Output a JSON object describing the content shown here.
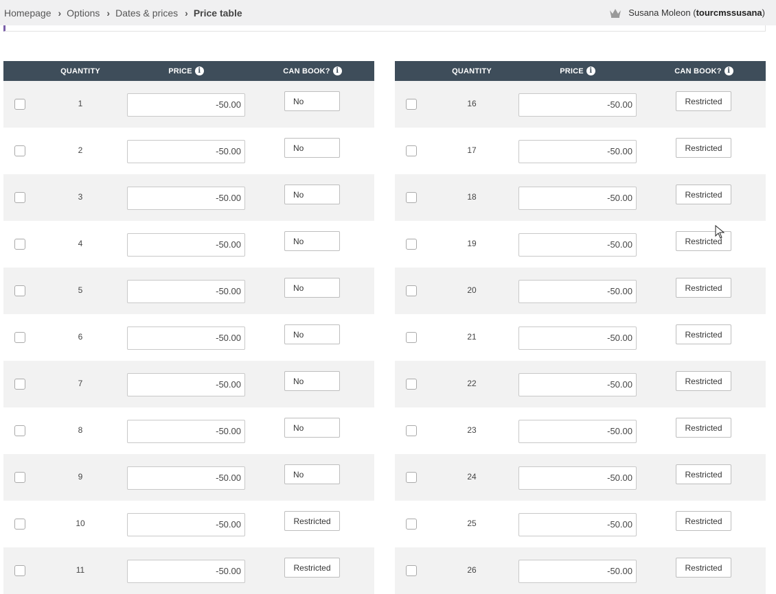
{
  "breadcrumb": {
    "items": [
      "Homepage",
      "Options",
      "Dates & prices"
    ],
    "current": "Price table"
  },
  "user": {
    "name": "Susana Moleon",
    "username_open": "(",
    "username": "tourcmssusana",
    "username_close": ")"
  },
  "table": {
    "headers": {
      "quantity": "QUANTITY",
      "price": "PRICE",
      "can_book": "CAN BOOK?"
    },
    "info_glyph": "i",
    "left_rows": [
      {
        "qty": "1",
        "price": "-50.00",
        "can_book": "No"
      },
      {
        "qty": "2",
        "price": "-50.00",
        "can_book": "No"
      },
      {
        "qty": "3",
        "price": "-50.00",
        "can_book": "No"
      },
      {
        "qty": "4",
        "price": "-50.00",
        "can_book": "No"
      },
      {
        "qty": "5",
        "price": "-50.00",
        "can_book": "No"
      },
      {
        "qty": "6",
        "price": "-50.00",
        "can_book": "No"
      },
      {
        "qty": "7",
        "price": "-50.00",
        "can_book": "No"
      },
      {
        "qty": "8",
        "price": "-50.00",
        "can_book": "No"
      },
      {
        "qty": "9",
        "price": "-50.00",
        "can_book": "No"
      },
      {
        "qty": "10",
        "price": "-50.00",
        "can_book": "Restricted"
      },
      {
        "qty": "11",
        "price": "-50.00",
        "can_book": "Restricted"
      }
    ],
    "right_rows": [
      {
        "qty": "16",
        "price": "-50.00",
        "can_book": "Restricted"
      },
      {
        "qty": "17",
        "price": "-50.00",
        "can_book": "Restricted"
      },
      {
        "qty": "18",
        "price": "-50.00",
        "can_book": "Restricted"
      },
      {
        "qty": "19",
        "price": "-50.00",
        "can_book": "Restricted"
      },
      {
        "qty": "20",
        "price": "-50.00",
        "can_book": "Restricted"
      },
      {
        "qty": "21",
        "price": "-50.00",
        "can_book": "Restricted"
      },
      {
        "qty": "22",
        "price": "-50.00",
        "can_book": "Restricted"
      },
      {
        "qty": "23",
        "price": "-50.00",
        "can_book": "Restricted"
      },
      {
        "qty": "24",
        "price": "-50.00",
        "can_book": "Restricted"
      },
      {
        "qty": "25",
        "price": "-50.00",
        "can_book": "Restricted"
      },
      {
        "qty": "26",
        "price": "-50.00",
        "can_book": "Restricted"
      }
    ]
  },
  "colors": {
    "header_bg": "#3e4d5a",
    "row_alt_bg": "#f2f2f2",
    "accent": "#7a5fa8"
  }
}
